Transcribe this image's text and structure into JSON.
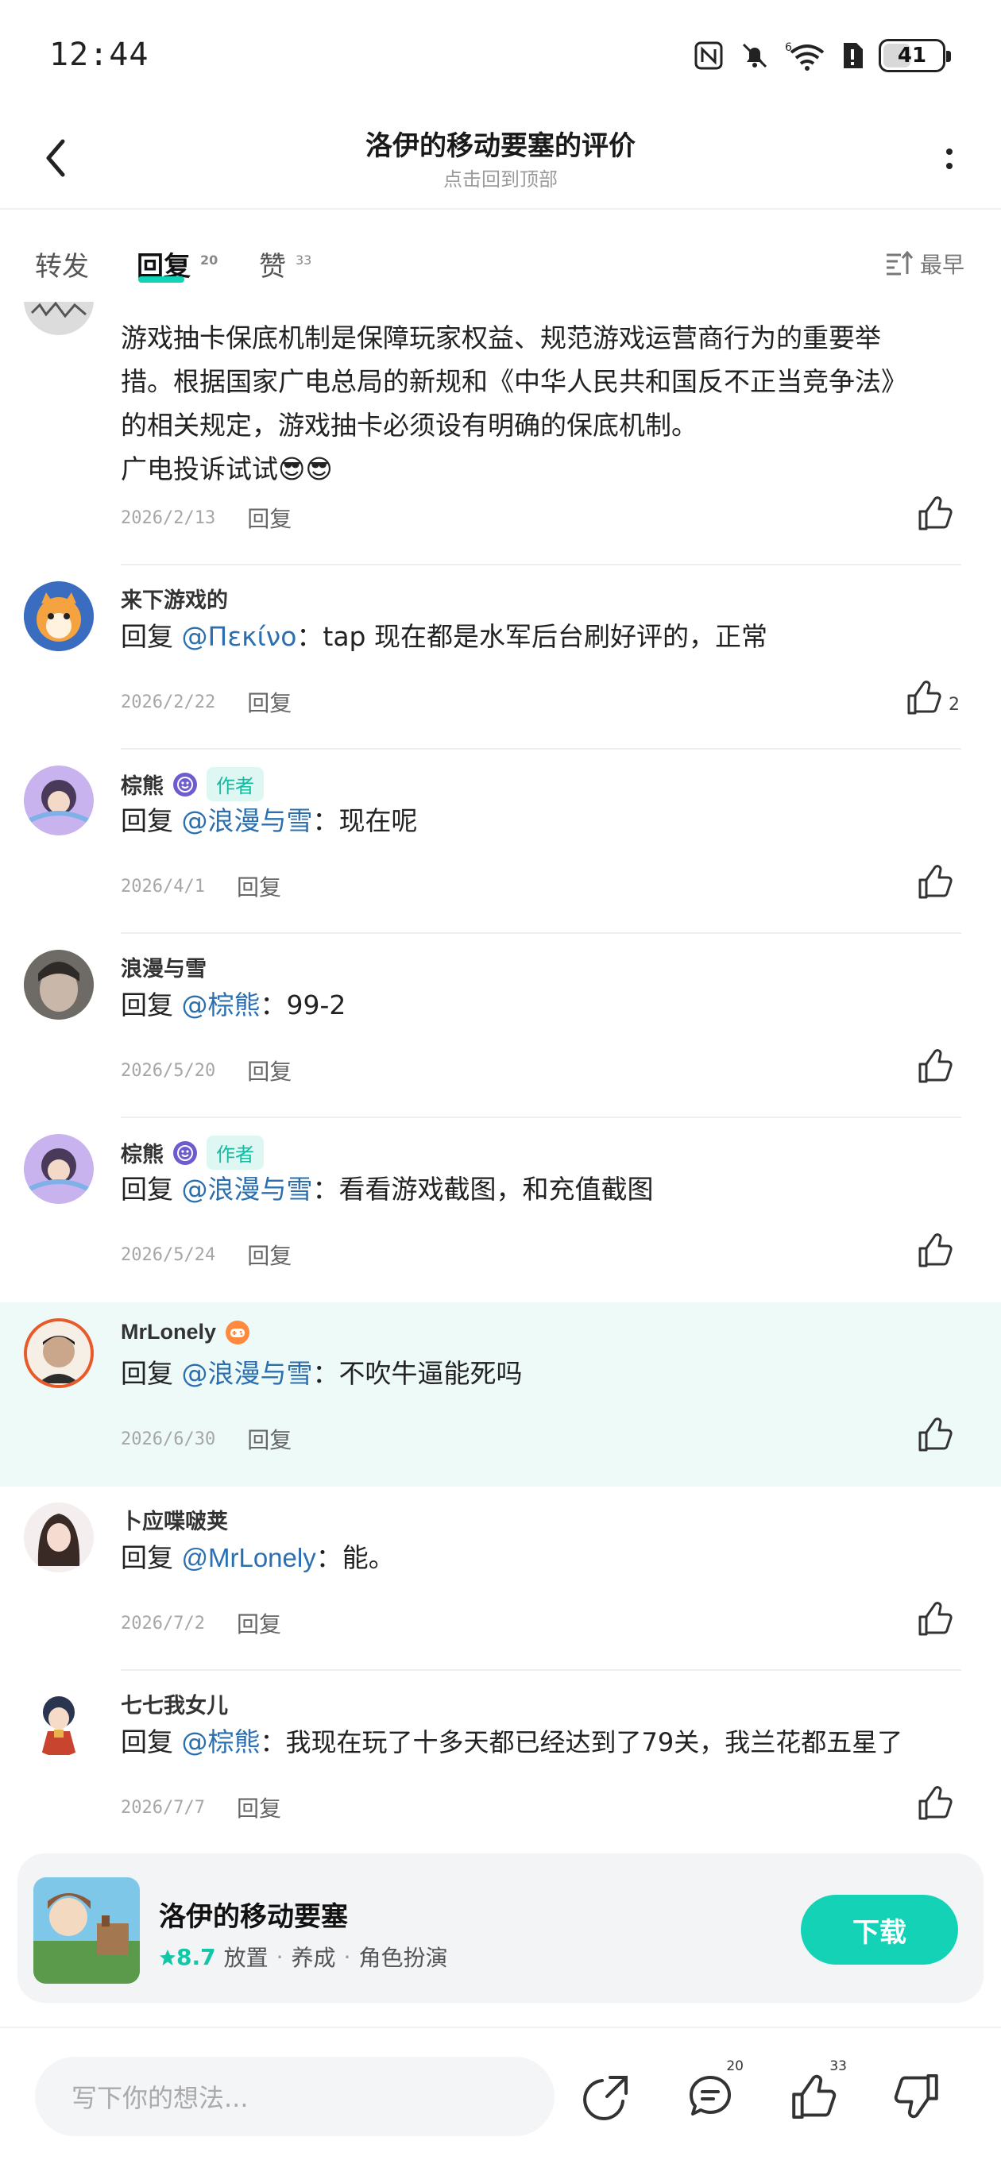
{
  "status_bar": {
    "time": "12:44",
    "battery": "41",
    "battery_level": 0.41,
    "network_label": "6"
  },
  "header": {
    "title": "洛伊的移动要塞的评价",
    "subtitle": "点击回到顶部"
  },
  "tabs": [
    {
      "label": "转发",
      "count": ""
    },
    {
      "label": "回复",
      "count": "20"
    },
    {
      "label": "赞",
      "count": "33"
    }
  ],
  "sort_label": "最早",
  "reply_prefix": "回复 ",
  "reply_label": "回复",
  "author_tag": "作者",
  "comments": [
    {
      "name": "",
      "text_lines": [
        "游戏抽卡保底机制是保障玩家权益、规范游戏运营商行为的重要举",
        "措。根据国家广电总局的新规和《中华人民共和国反不正当竞争法》",
        "的相关规定，游戏抽卡必须设有明确的保底机制。",
        "广电投诉试试😎😎"
      ],
      "date": "2026/2/13",
      "likes": ""
    },
    {
      "name": "来下游戏的",
      "mention": "@Πεκίνο",
      "text": "：tap 现在都是水军后台刷好评的，正常",
      "date": "2026/2/22",
      "likes": "2"
    },
    {
      "name": "棕熊",
      "author": true,
      "mention": "@浪漫与雪",
      "text": "：现在呢",
      "date": "2026/4/1",
      "likes": ""
    },
    {
      "name": "浪漫与雪",
      "mention": "@棕熊",
      "text": "：99-2",
      "date": "2026/5/20",
      "likes": ""
    },
    {
      "name": "棕熊",
      "author": true,
      "mention": "@浪漫与雪",
      "text": "：看看游戏截图，和充值截图",
      "date": "2026/5/24",
      "likes": ""
    },
    {
      "name": "MrLonely",
      "mention": "@浪漫与雪",
      "text": "：不吹牛逼能死吗",
      "date": "2026/6/30",
      "likes": ""
    },
    {
      "name": "卜应喋啵荚",
      "mention": "@MrLonely",
      "text": "：能。",
      "date": "2026/7/2",
      "likes": ""
    },
    {
      "name": "七七我女儿",
      "mention": "@棕熊",
      "text": "：我现在玩了十多天都已经达到了79关，我兰花都五星了",
      "date": "2026/7/7",
      "likes": ""
    }
  ],
  "game_card": {
    "name": "洛伊的移动要塞",
    "rating": "8.7",
    "tags": [
      "放置",
      "养成",
      "角色扮演"
    ],
    "download_label": "下载"
  },
  "bottom_bar": {
    "placeholder": "写下你的想法...",
    "comment_count": "20",
    "like_count": "33"
  },
  "colors": {
    "accent": "#14d2b6",
    "mention": "#2b6fb0",
    "highlight_bg": "#eefaf8"
  }
}
